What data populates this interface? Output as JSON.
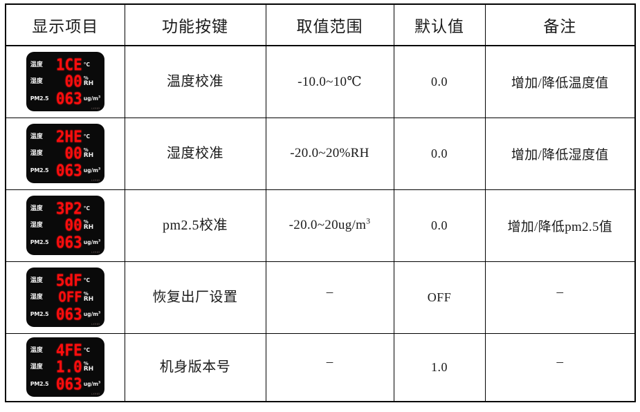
{
  "table": {
    "headers": [
      {
        "label": "显示项目"
      },
      {
        "label": "功能按键"
      },
      {
        "label": "取值范围"
      },
      {
        "label": "默认值"
      },
      {
        "label": "备注"
      }
    ],
    "header_color": "#ff4136",
    "rows": [
      {
        "display": {
          "temp_label": "温度",
          "temp_value": "1CE",
          "temp_unit": "°C",
          "hum_label": "湿度",
          "hum_value": "00",
          "hum_unit_1": "%",
          "hum_unit_2": "RH",
          "pm_label": "PM2.5",
          "pm_value": "063",
          "pm_unit": "ug/m",
          "pm_unit_sup": "3",
          "watermark": "LX965"
        },
        "function": "温度校准",
        "range": "-10.0~10℃",
        "default": "0.0",
        "note": "增加/降低温度值"
      },
      {
        "display": {
          "temp_label": "温度",
          "temp_value": "2HE",
          "temp_unit": "°C",
          "hum_label": "湿度",
          "hum_value": "00",
          "hum_unit_1": "%",
          "hum_unit_2": "RH",
          "pm_label": "PM2.5",
          "pm_value": "063",
          "pm_unit": "ug/m",
          "pm_unit_sup": "3",
          "watermark": "LX965"
        },
        "function": "湿度校准",
        "range": "-20.0~20%RH",
        "default": "0.0",
        "note": "增加/降低湿度值"
      },
      {
        "display": {
          "temp_label": "温度",
          "temp_value": "3P2",
          "temp_unit": "°C",
          "hum_label": "湿度",
          "hum_value": "00",
          "hum_unit_1": "%",
          "hum_unit_2": "RH",
          "pm_label": "PM2.5",
          "pm_value": "063",
          "pm_unit": "ug/m",
          "pm_unit_sup": "3",
          "watermark": "LX965"
        },
        "function": "pm2.5校准",
        "range_prefix": "-20.0~20ug/m",
        "range_sup": "3",
        "default": "0.0",
        "note": "增加/降低pm2.5值"
      },
      {
        "display": {
          "temp_label": "温度",
          "temp_value": "5dF",
          "temp_unit": "°C",
          "hum_label": "湿度",
          "hum_value": "OFF",
          "hum_unit_1": "%",
          "hum_unit_2": "RH",
          "pm_label": "PM2.5",
          "pm_value": "063",
          "pm_unit": "ug/m",
          "pm_unit_sup": "3",
          "watermark": "LX965"
        },
        "function": "恢复出厂设置",
        "range": "–",
        "default": "OFF",
        "note": "–"
      },
      {
        "display": {
          "temp_label": "温度",
          "temp_value": "4FE",
          "temp_unit": "°C",
          "hum_label": "湿度",
          "hum_value": "1.0",
          "hum_unit_1": "%",
          "hum_unit_2": "RH",
          "pm_label": "PM2.5",
          "pm_value": "063",
          "pm_unit": "ug/m",
          "pm_unit_sup": "3",
          "watermark": "LX965"
        },
        "function": "机身版本号",
        "range": "–",
        "default": "1.0",
        "note": "–"
      }
    ]
  }
}
